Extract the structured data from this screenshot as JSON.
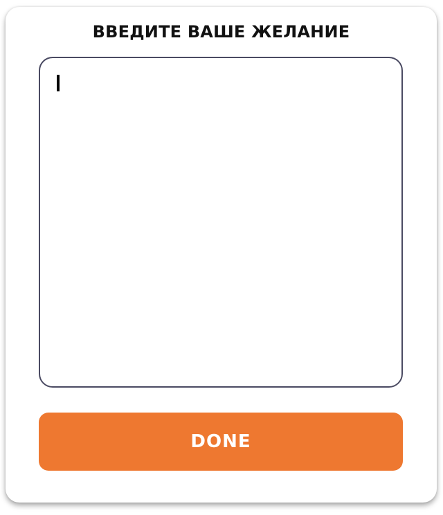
{
  "dialog": {
    "title": "ВВЕДИТЕ ВАШЕ ЖЕЛАНИЕ",
    "wish_input": {
      "value": "",
      "placeholder": ""
    },
    "done_label": "DONE"
  },
  "colors": {
    "accent": "#ee7830",
    "input_border": "#4a4a62",
    "background": "#ffffff"
  }
}
